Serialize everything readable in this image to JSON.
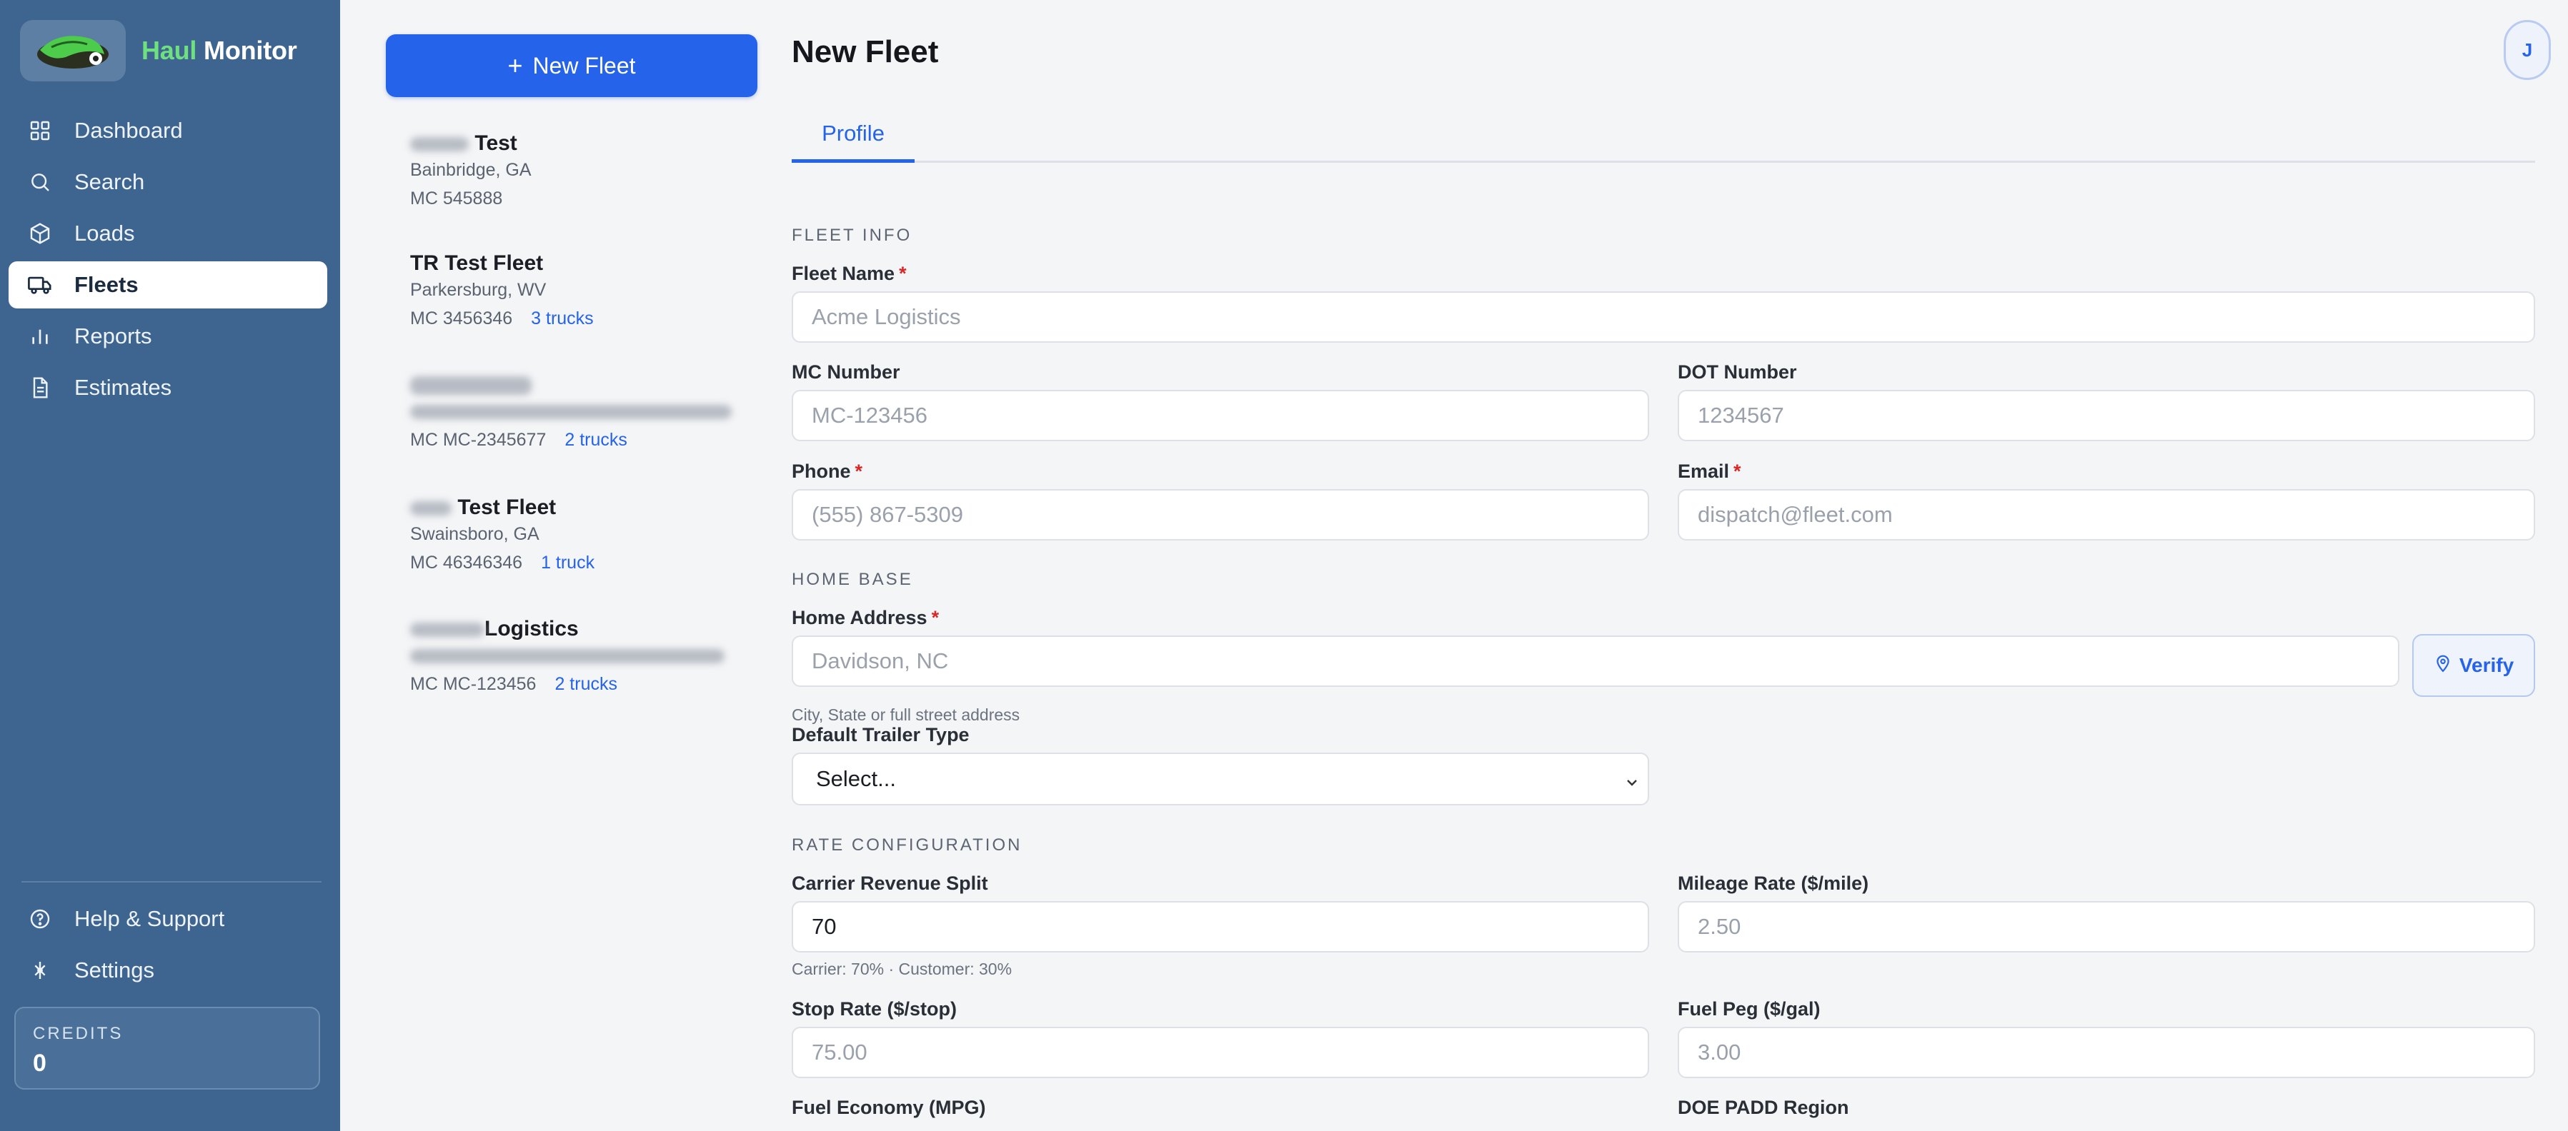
{
  "app": {
    "brand_part1": "Haul",
    "brand_part2": "Monitor",
    "accent": "#2563eb",
    "sidebar_bg": "#3e6590"
  },
  "sidebar": {
    "items": [
      {
        "label": "Dashboard",
        "icon": "grid-icon"
      },
      {
        "label": "Search",
        "icon": "search-icon"
      },
      {
        "label": "Loads",
        "icon": "box-icon"
      },
      {
        "label": "Fleets",
        "icon": "truck-icon",
        "active": true
      },
      {
        "label": "Reports",
        "icon": "bar-chart-icon"
      },
      {
        "label": "Estimates",
        "icon": "document-icon"
      }
    ],
    "bottom": [
      {
        "label": "Help & Support",
        "icon": "help-circle-icon"
      },
      {
        "label": "Settings",
        "icon": "settings-icon"
      }
    ],
    "credits": {
      "label": "CREDITS",
      "value": "0"
    }
  },
  "fleet_list": {
    "new_button": "New Fleet",
    "fleets": [
      {
        "name": "Test",
        "location": "Bainbridge, GA",
        "mc": "MC 545888",
        "trucks": ""
      },
      {
        "name": "TR Test Fleet",
        "location": "Parkersburg, WV",
        "mc": "MC 3456346",
        "trucks": "3 trucks"
      },
      {
        "name": "",
        "location": "",
        "mc": "MC MC-2345677",
        "trucks": "2 trucks"
      },
      {
        "name": "Test Fleet",
        "location": "Swainsboro, GA",
        "mc": "MC 46346346",
        "trucks": "1 truck"
      },
      {
        "name": "Logistics",
        "location": "",
        "mc": "MC MC-123456",
        "trucks": "2 trucks"
      }
    ]
  },
  "main": {
    "title": "New Fleet",
    "avatar": "J",
    "tab": "Profile",
    "fleet_info": {
      "heading": "FLEET INFO",
      "fleet_name": {
        "label": "Fleet Name",
        "placeholder": "Acme Logistics"
      },
      "mc_number": {
        "label": "MC Number",
        "placeholder": "MC-123456"
      },
      "dot_number": {
        "label": "DOT Number",
        "placeholder": "1234567"
      },
      "phone": {
        "label": "Phone",
        "placeholder": "(555) 867-5309"
      },
      "email": {
        "label": "Email",
        "placeholder": "dispatch@fleet.com"
      }
    },
    "home_base": {
      "heading": "HOME BASE",
      "address": {
        "label": "Home Address",
        "placeholder": "Davidson, NC",
        "helper": "City, State or full street address"
      },
      "verify_button": "Verify",
      "trailer_type": {
        "label": "Default Trailer Type",
        "value": "Select..."
      }
    },
    "rate_config": {
      "heading": "RATE CONFIGURATION",
      "revenue_split": {
        "label": "Carrier Revenue Split",
        "value": "70",
        "helper": "Carrier: 70% · Customer: 30%"
      },
      "mileage_rate": {
        "label": "Mileage Rate ($/mile)",
        "placeholder": "2.50"
      },
      "stop_rate": {
        "label": "Stop Rate ($/stop)",
        "placeholder": "75.00"
      },
      "fuel_peg": {
        "label": "Fuel Peg ($/gal)",
        "placeholder": "3.00"
      },
      "fuel_economy": {
        "label": "Fuel Economy (MPG)"
      },
      "doe_padd": {
        "label": "DOE PADD Region"
      }
    }
  }
}
